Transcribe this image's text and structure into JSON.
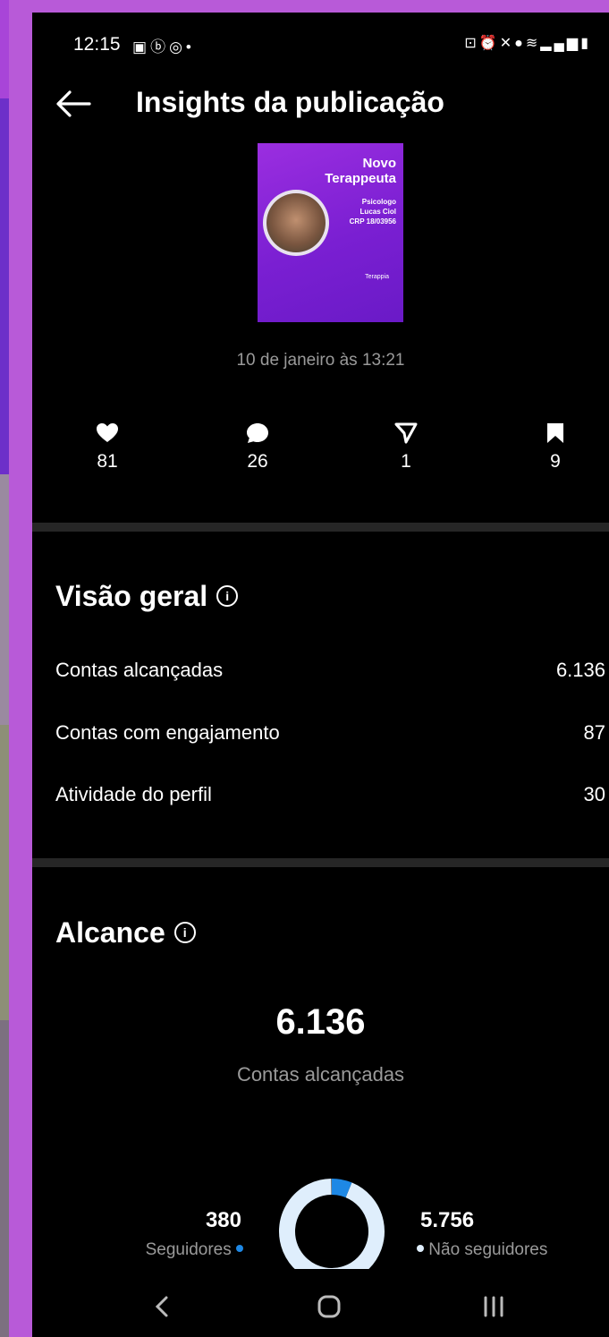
{
  "status_bar": {
    "time": "12:15",
    "left_icons": [
      "image-icon",
      "b-icon",
      "instagram-icon",
      "dot-icon"
    ],
    "right_icons": [
      "lock-icon",
      "alarm-icon",
      "mute-icon",
      "location-icon",
      "wifi-icon",
      "volte-icon",
      "signal-icon",
      "battery-icon"
    ]
  },
  "header": {
    "title": "Insights da publicação"
  },
  "post": {
    "thumbnail": {
      "headline_lines": [
        "Novo",
        "Terappeuta"
      ],
      "detail_lines": [
        "Psicologo",
        "Lucas Ciol",
        "CRP 18/03956"
      ],
      "brand": "Terappia"
    },
    "date": "10 de janeiro às 13:21"
  },
  "stats": {
    "likes": "81",
    "comments": "26",
    "shares": "1",
    "saves": "9"
  },
  "overview": {
    "title": "Visão geral",
    "rows": [
      {
        "label": "Contas alcançadas",
        "value": "6.136"
      },
      {
        "label": "Contas com engajamento",
        "value": "87"
      },
      {
        "label": "Atividade do perfil",
        "value": "30"
      }
    ]
  },
  "reach": {
    "title": "Alcance",
    "total": "6.136",
    "total_label": "Contas alcançadas",
    "followers": {
      "value": "380",
      "label": "Seguidores",
      "color": "#1e88e5"
    },
    "non_followers": {
      "value": "5.756",
      "label": "Não seguidores",
      "color": "#dfeefc"
    },
    "follower_fraction": 0.062
  },
  "colors": {
    "background": "#000000",
    "accent": "#1e88e5",
    "muted_text": "#9a9a9a",
    "separator": "#262626",
    "outer_frame": "#b85ad8"
  },
  "nav_bar": {
    "icons": [
      "back-nav-icon",
      "home-nav-icon",
      "recents-nav-icon"
    ]
  }
}
